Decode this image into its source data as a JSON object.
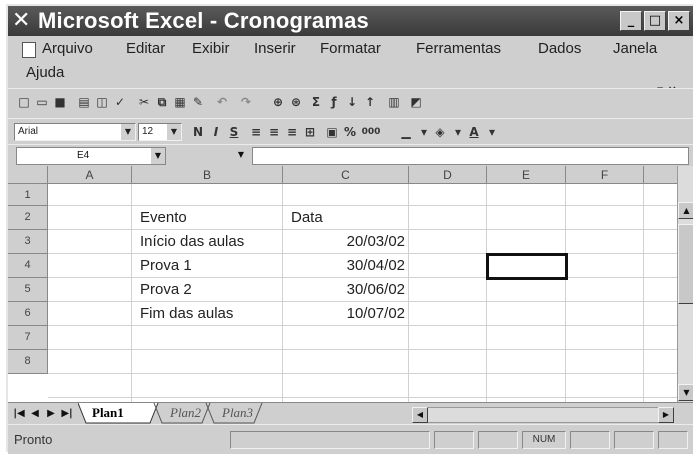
{
  "window": {
    "app_icon": "excel-icon",
    "title": "Microsoft Excel - Cronogramas",
    "controls": [
      "_",
      "□",
      "×"
    ]
  },
  "menu": {
    "items": [
      {
        "label": "Arquivo"
      },
      {
        "label": "Editar"
      },
      {
        "label": "Exibir"
      },
      {
        "label": "Inserir"
      },
      {
        "label": "Formatar"
      },
      {
        "label": "Ferramentas"
      },
      {
        "label": "Dados"
      },
      {
        "label": "Janela"
      },
      {
        "label": "Ajuda"
      }
    ]
  },
  "format_bar": {
    "font": "Arial",
    "size": "12",
    "bold": "N",
    "italic": "I",
    "underline": "S",
    "percent": "%",
    "thousands": "000"
  },
  "formula_bar": {
    "name_box": "E4",
    "content": ""
  },
  "grid": {
    "columns": [
      "A",
      "B",
      "C",
      "D",
      "E",
      "F"
    ],
    "rows": [
      "1",
      "2",
      "3",
      "4",
      "5",
      "6",
      "7",
      "8"
    ],
    "cells": [
      {
        "row": 2,
        "col": "B",
        "value": "Evento"
      },
      {
        "row": 2,
        "col": "C",
        "value": "Data"
      },
      {
        "row": 3,
        "col": "B",
        "value": "Início das aulas"
      },
      {
        "row": 3,
        "col": "C",
        "value": "20/03/02"
      },
      {
        "row": 4,
        "col": "B",
        "value": "Prova 1"
      },
      {
        "row": 4,
        "col": "C",
        "value": "30/04/02"
      },
      {
        "row": 5,
        "col": "B",
        "value": "Prova 2"
      },
      {
        "row": 5,
        "col": "C",
        "value": "30/06/02"
      },
      {
        "row": 6,
        "col": "B",
        "value": "Fim das aulas"
      },
      {
        "row": 6,
        "col": "C",
        "value": "10/07/02"
      }
    ],
    "selected_cell": "E4"
  },
  "sheet_tabs": {
    "tabs": [
      "Plan1",
      "Plan2",
      "Plan3"
    ],
    "active": "Plan1"
  },
  "status": {
    "text": "Pronto",
    "num": "NUM"
  }
}
